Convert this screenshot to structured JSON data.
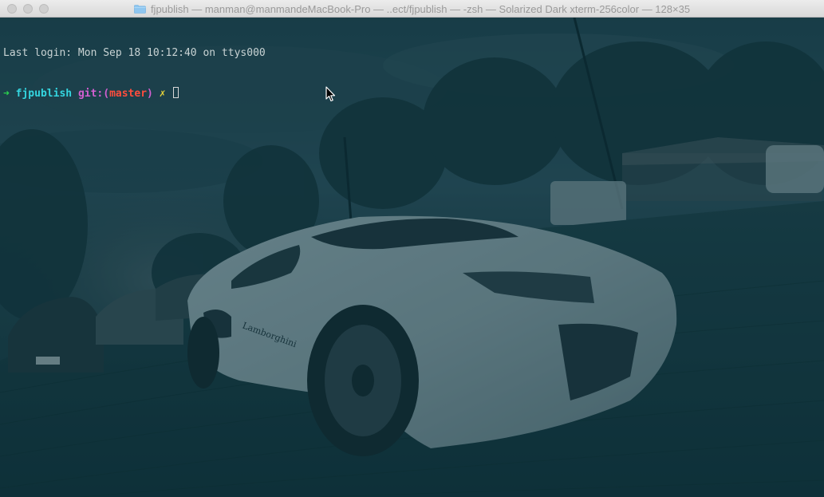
{
  "window": {
    "title": "fjpublish — manman@manmandeMacBook-Pro — ..ect/fjpublish — -zsh — Solarized Dark xterm-256color — 128×35",
    "folder_icon": "folder-icon",
    "controls": [
      "close",
      "minimize",
      "zoom"
    ]
  },
  "terminal": {
    "theme": "Solarized Dark",
    "background_image": "white sports car on cobblestone street",
    "colors": {
      "background": "#1f4148",
      "text": "#c9d3d4",
      "prompt_arrow": "#2bd14d",
      "directory": "#34d6e0",
      "git_label": "#d25fd0",
      "branch": "#ff4d3d",
      "dirty_marker": "#e6d43a"
    },
    "last_login": "Last login: Mon Sep 18 10:12:40 on ttys000",
    "prompt": {
      "arrow": "➜",
      "directory": "fjpublish",
      "git_label": "git:(",
      "branch": "master",
      "git_close": ")",
      "dirty": "✗"
    }
  }
}
